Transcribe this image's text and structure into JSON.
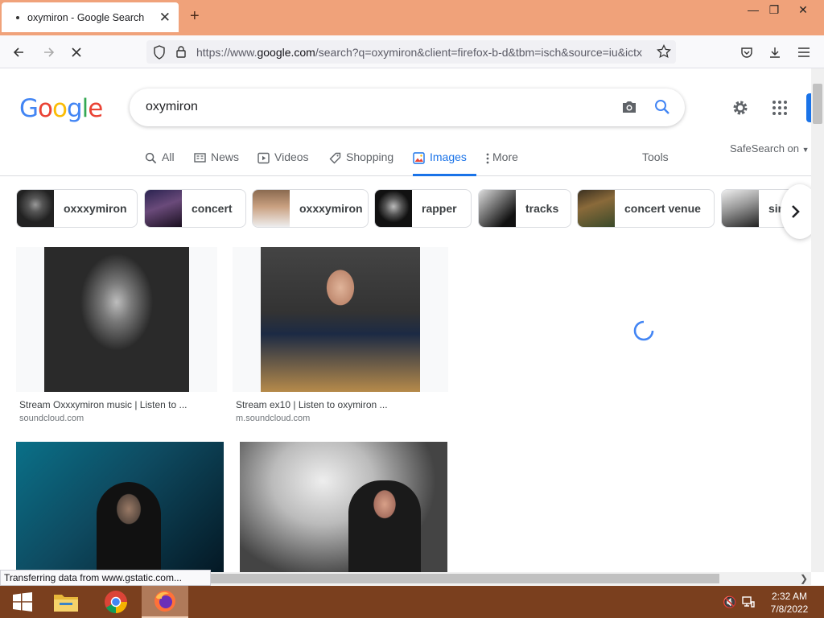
{
  "browser": {
    "tab_title": "oxymiron - Google Search",
    "url_prefix": "https://www.",
    "url_domain": "google.com",
    "url_rest": "/search?q=oxymiron&client=firefox-b-d&tbm=isch&source=iu&ictx",
    "status": "Transferring data from www.gstatic.com..."
  },
  "google": {
    "query": "oxymiron",
    "tabs": [
      {
        "label": "All",
        "icon": "search-icon"
      },
      {
        "label": "News",
        "icon": "news-icon"
      },
      {
        "label": "Videos",
        "icon": "video-icon"
      },
      {
        "label": "Shopping",
        "icon": "tag-icon"
      },
      {
        "label": "Images",
        "icon": "image-icon",
        "active": true
      },
      {
        "label": "More",
        "icon": "more-vert-icon"
      }
    ],
    "tools_label": "Tools",
    "safesearch_label": "SafeSearch on"
  },
  "chips": [
    {
      "label": "oxxxymiron"
    },
    {
      "label": "concert"
    },
    {
      "label": "oxxxymiron"
    },
    {
      "label": "rapper"
    },
    {
      "label": "tracks"
    },
    {
      "label": "concert venue"
    },
    {
      "label": "sin"
    }
  ],
  "results": [
    {
      "caption": "Stream Oxxxymiron music | Listen to ...",
      "source": "soundcloud.com"
    },
    {
      "caption": "Stream ex10 | Listen to oxymiron ...",
      "source": "m.soundcloud.com"
    },
    {
      "caption": "",
      "source": ""
    },
    {
      "caption": "",
      "source": ""
    }
  ],
  "taskbar": {
    "time": "2:32 AM",
    "date": "7/8/2022"
  },
  "colors": {
    "accent": "#1a73e8",
    "tabbar": "#f0a27a",
    "taskbar": "#7a3f1e"
  }
}
